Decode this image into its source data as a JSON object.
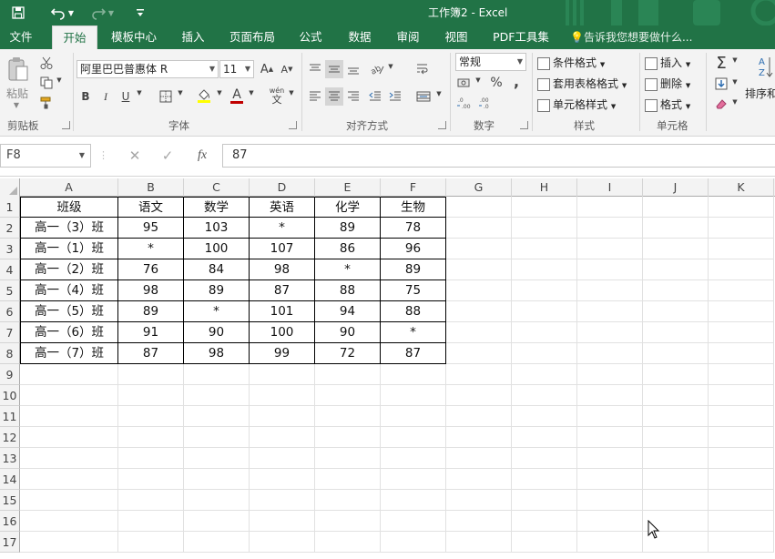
{
  "window": {
    "title": "工作簿2 - Excel"
  },
  "tabs": [
    {
      "label": "文件"
    },
    {
      "label": "开始"
    },
    {
      "label": "模板中心"
    },
    {
      "label": "插入"
    },
    {
      "label": "页面布局"
    },
    {
      "label": "公式"
    },
    {
      "label": "数据"
    },
    {
      "label": "审阅"
    },
    {
      "label": "视图"
    },
    {
      "label": "PDF工具集"
    }
  ],
  "tell_me": "告诉我您想要做什么...",
  "ribbon": {
    "clipboard": {
      "label": "剪贴板",
      "paste": "粘贴"
    },
    "font": {
      "label": "字体",
      "name": "阿里巴巴普惠体 R",
      "size": "11",
      "bold": "B",
      "italic": "I",
      "underline": "U",
      "wen": "wén",
      "font_color_glyph": "A"
    },
    "alignment": {
      "label": "对齐方式"
    },
    "number": {
      "label": "数字",
      "format": "常规",
      "percent": "%",
      "comma": ","
    },
    "styles": {
      "label": "样式",
      "conditional": "条件格式",
      "table_format": "套用表格格式",
      "cell_styles": "单元格样式"
    },
    "cells": {
      "label": "单元格",
      "insert": "插入",
      "delete": "删除",
      "format": "格式"
    },
    "editing": {
      "sort_filter": "排序和"
    }
  },
  "formula_bar": {
    "name_box": "F8",
    "fx": "fx",
    "value": "87"
  },
  "columns": [
    "A",
    "B",
    "C",
    "D",
    "E",
    "F",
    "G",
    "H",
    "I",
    "J",
    "K"
  ],
  "rows": [
    "1",
    "2",
    "3",
    "4",
    "5",
    "6",
    "7",
    "8",
    "9",
    "10",
    "11",
    "12",
    "13",
    "14",
    "15",
    "16",
    "17"
  ],
  "table": {
    "header": [
      "班级",
      "语文",
      "数学",
      "英语",
      "化学",
      "生物"
    ],
    "data": [
      [
        "高一（3）班",
        "95",
        "103",
        "*",
        "89",
        "78"
      ],
      [
        "高一（1）班",
        "*",
        "100",
        "107",
        "86",
        "96"
      ],
      [
        "高一（2）班",
        "76",
        "84",
        "98",
        "*",
        "89"
      ],
      [
        "高一（4）班",
        "98",
        "89",
        "87",
        "88",
        "75"
      ],
      [
        "高一（5）班",
        "89",
        "*",
        "101",
        "94",
        "88"
      ],
      [
        "高一（6）班",
        "91",
        "90",
        "100",
        "90",
        "*"
      ],
      [
        "高一（7）班",
        "87",
        "98",
        "99",
        "72",
        "87"
      ]
    ]
  },
  "colors": {
    "brand": "#217346",
    "ribbon_bg": "#f3f3f3"
  },
  "icons": [
    "save-icon",
    "undo-icon",
    "redo-icon",
    "customize-icon",
    "lightbulb-icon",
    "cut-icon",
    "copy-icon",
    "format-painter-icon",
    "sum-icon",
    "fill-icon",
    "clear-icon",
    "sort-icon",
    "cancel-icon",
    "enter-icon",
    "function-icon",
    "cursor-icon"
  ]
}
